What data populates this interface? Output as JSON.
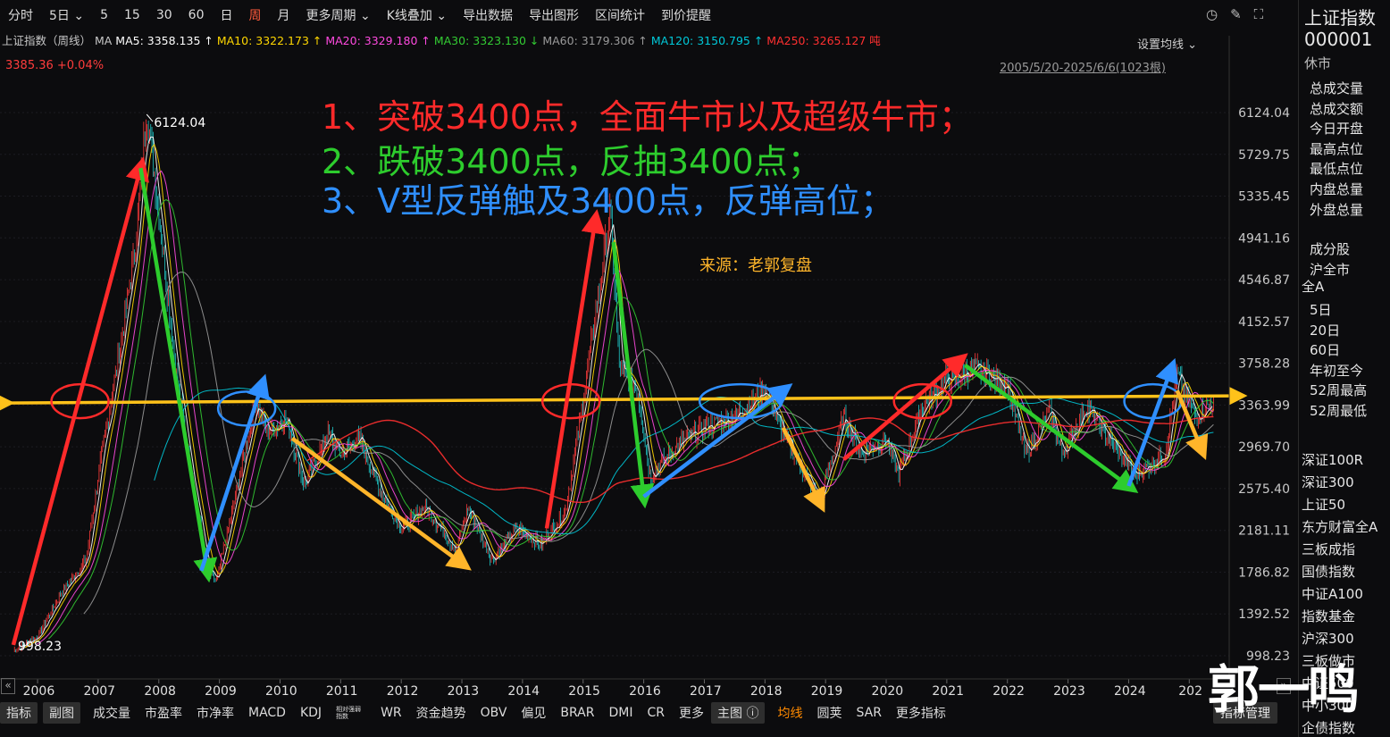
{
  "toolbar": {
    "items": [
      "分时",
      "5日 ⌄",
      "5",
      "15",
      "30",
      "60",
      "日",
      "周",
      "月",
      "更多周期 ⌄",
      "K线叠加 ⌄",
      "导出数据",
      "导出图形",
      "区间统计",
      "到价提醒"
    ],
    "active": "周",
    "icons": [
      "clock-icon",
      "pen-icon",
      "fullscreen-icon"
    ]
  },
  "ma_line": {
    "name": "上证指数（周线）",
    "prefix": "MA",
    "items": [
      {
        "label": "MA5:",
        "value": "3358.135",
        "arrow": "↑",
        "color": "#ffffff"
      },
      {
        "label": "MA10:",
        "value": "3322.173",
        "arrow": "↑",
        "color": "#ffd700"
      },
      {
        "label": "MA20:",
        "value": "3329.180",
        "arrow": "↑",
        "color": "#ff4ae0"
      },
      {
        "label": "MA30:",
        "value": "3323.130",
        "arrow": "↓",
        "color": "#33cc33"
      },
      {
        "label": "MA60:",
        "value": "3179.306",
        "arrow": "↑",
        "color": "#9a9a9a"
      },
      {
        "label": "MA120:",
        "value": "3150.795",
        "arrow": "↑",
        "color": "#00c8d8"
      },
      {
        "label": "MA250:",
        "value": "3265.127",
        "arrow": "吨",
        "color": "#ff3030"
      }
    ]
  },
  "price": "3385.36  +0.04%",
  "set_ma": "设置均线 ⌄",
  "range": "2005/5/20-2025/6/6(1023根)",
  "y_axis": [
    "6124.04",
    "5729.75",
    "5335.45",
    "4941.16",
    "4546.87",
    "4152.57",
    "3758.28",
    "3363.99",
    "2969.70",
    "2575.40",
    "2181.11",
    "1786.82",
    "1392.52",
    "998.23"
  ],
  "x_axis": [
    "2006",
    "2007",
    "2008",
    "2009",
    "2010",
    "2011",
    "2012",
    "2013",
    "2014",
    "2015",
    "2016",
    "2017",
    "2018",
    "2019",
    "2020",
    "2021",
    "2022",
    "2023",
    "2024",
    "202"
  ],
  "peak_label": "6124.04",
  "low_label": "998.23",
  "annotations": [
    {
      "text": "1、突破3400点，全面牛市以及超级牛市；",
      "color": "#ff2a2a"
    },
    {
      "text": "2、跌破3400点，反抽3400点；",
      "color": "#2dcc2d"
    },
    {
      "text": "3、V型反弹触及3400点，反弹高位；",
      "color": "#2f8fff"
    }
  ],
  "source": "来源：老郭复盘",
  "watermark": "郭一鸣",
  "sidebar": {
    "title": "上证指数",
    "code": "000001",
    "status": "休市",
    "stats": [
      "总成交量",
      "总成交额",
      "今日开盘",
      "最高点位",
      "最低点位",
      "内盘总量",
      "外盘总量"
    ],
    "group": [
      "成分股",
      "沪全市",
      "全A"
    ],
    "periods": [
      "5日",
      "20日",
      "60日",
      "年初至今",
      "52周最高",
      "52周最低"
    ],
    "indices": [
      "深证100R",
      "深证300",
      "上证50",
      "东方财富全A",
      "三板成指",
      "国债指数",
      "中证A100",
      "指数基金",
      "沪深300",
      "三板做市",
      "中证500",
      "中小300",
      "企债指数"
    ]
  },
  "bottom": {
    "items": [
      "指标",
      "副图",
      "成交量",
      "市盈率",
      "市净率",
      "MACD",
      "KDJ",
      "相对强弱指数",
      "WR",
      "资金趋势",
      "OBV",
      "偏见",
      "BRAR",
      "DMI",
      "CR",
      "更多",
      "主图 ⓘ",
      "均线",
      "圆荚",
      "SAR",
      "更多指标"
    ],
    "manage": "指标管理"
  },
  "chart_data": {
    "type": "candlestick",
    "period": "weekly",
    "ylim": [
      998.23,
      6124.04
    ],
    "support_level": 3400,
    "x_labels": [
      "2006",
      "2007",
      "2008",
      "2009",
      "2010",
      "2011",
      "2012",
      "2013",
      "2014",
      "2015",
      "2016",
      "2017",
      "2018",
      "2019",
      "2020",
      "2021",
      "2022",
      "2023",
      "2024",
      "202"
    ],
    "path": [
      [
        2005.6,
        1050
      ],
      [
        2006.0,
        1180
      ],
      [
        2006.4,
        1600
      ],
      [
        2006.8,
        1900
      ],
      [
        2007.0,
        2700
      ],
      [
        2007.3,
        3700
      ],
      [
        2007.6,
        4800
      ],
      [
        2007.8,
        6124
      ],
      [
        2008.0,
        5200
      ],
      [
        2008.3,
        3600
      ],
      [
        2008.6,
        2500
      ],
      [
        2008.8,
        1800
      ],
      [
        2008.95,
        1700
      ],
      [
        2009.3,
        2600
      ],
      [
        2009.6,
        3400
      ],
      [
        2009.8,
        3100
      ],
      [
        2010.1,
        3250
      ],
      [
        2010.4,
        2600
      ],
      [
        2010.8,
        3100
      ],
      [
        2011.0,
        2900
      ],
      [
        2011.3,
        3050
      ],
      [
        2011.7,
        2500
      ],
      [
        2012.0,
        2200
      ],
      [
        2012.4,
        2400
      ],
      [
        2012.9,
        2000
      ],
      [
        2013.1,
        2400
      ],
      [
        2013.5,
        1900
      ],
      [
        2013.9,
        2200
      ],
      [
        2014.3,
        2050
      ],
      [
        2014.7,
        2350
      ],
      [
        2014.95,
        3200
      ],
      [
        2015.2,
        4200
      ],
      [
        2015.45,
        5178
      ],
      [
        2015.6,
        3700
      ],
      [
        2015.9,
        3500
      ],
      [
        2016.1,
        2700
      ],
      [
        2016.6,
        3000
      ],
      [
        2017.0,
        3150
      ],
      [
        2017.5,
        3250
      ],
      [
        2018.0,
        3500
      ],
      [
        2018.3,
        3100
      ],
      [
        2018.9,
        2450
      ],
      [
        2019.3,
        3250
      ],
      [
        2019.6,
        2900
      ],
      [
        2020.0,
        3050
      ],
      [
        2020.2,
        2700
      ],
      [
        2020.6,
        3350
      ],
      [
        2021.0,
        3600
      ],
      [
        2021.5,
        3700
      ],
      [
        2022.0,
        3550
      ],
      [
        2022.3,
        2900
      ],
      [
        2022.7,
        3300
      ],
      [
        2022.9,
        2900
      ],
      [
        2023.3,
        3350
      ],
      [
        2023.8,
        2950
      ],
      [
        2024.1,
        2700
      ],
      [
        2024.6,
        2900
      ],
      [
        2024.8,
        3650
      ],
      [
        2025.1,
        3250
      ],
      [
        2025.4,
        3385
      ]
    ],
    "ma_series": [
      {
        "name": "MA5",
        "color": "#ffffff"
      },
      {
        "name": "MA10",
        "color": "#ffd700"
      },
      {
        "name": "MA20",
        "color": "#ff4ae0"
      },
      {
        "name": "MA30",
        "color": "#33cc33"
      },
      {
        "name": "MA60",
        "color": "#9a9a9a"
      },
      {
        "name": "MA120",
        "color": "#00c8d8"
      },
      {
        "name": "MA250",
        "color": "#ff3030"
      }
    ],
    "arrows": [
      {
        "color": "#ff2a2a",
        "from": [
          2005.6,
          1100
        ],
        "to": [
          2007.7,
          5600
        ]
      },
      {
        "color": "#ff2a2a",
        "from": [
          2014.4,
          2200
        ],
        "to": [
          2015.2,
          5100
        ]
      },
      {
        "color": "#ff2a2a",
        "from": [
          2019.3,
          2850
        ],
        "to": [
          2021.2,
          3780
        ]
      },
      {
        "color": "#2dcc2d",
        "from": [
          2007.7,
          5600
        ],
        "to": [
          2008.8,
          1800
        ]
      },
      {
        "color": "#2dcc2d",
        "from": [
          2015.5,
          4900
        ],
        "to": [
          2016.0,
          2500
        ]
      },
      {
        "color": "#2dcc2d",
        "from": [
          2021.3,
          3740
        ],
        "to": [
          2024.0,
          2600
        ]
      },
      {
        "color": "#2f8fff",
        "from": [
          2008.7,
          1800
        ],
        "to": [
          2009.7,
          3550
        ]
      },
      {
        "color": "#2f8fff",
        "from": [
          2016.0,
          2500
        ],
        "to": [
          2018.3,
          3500
        ]
      },
      {
        "color": "#2f8fff",
        "from": [
          2024.0,
          2600
        ],
        "to": [
          2024.7,
          3700
        ]
      },
      {
        "color": "#ffb52a",
        "from": [
          2010.2,
          3050
        ],
        "to": [
          2013.0,
          1870
        ]
      },
      {
        "color": "#ffb52a",
        "from": [
          2018.3,
          3150
        ],
        "to": [
          2018.9,
          2450
        ]
      },
      {
        "color": "#ffb52a",
        "from": [
          2024.8,
          3500
        ],
        "to": [
          2025.2,
          2950
        ]
      }
    ],
    "ellipses": [
      {
        "color": "#ff2a2a",
        "x": 2006.7,
        "y": 3400
      },
      {
        "color": "#ff2a2a",
        "x": 2014.8,
        "y": 3400
      },
      {
        "color": "#ff2a2a",
        "x": 2020.6,
        "y": 3400
      },
      {
        "color": "#2f8fff",
        "x": 2009.45,
        "y": 3330
      },
      {
        "color": "#2f8fff",
        "x": 2017.6,
        "y": 3400
      },
      {
        "color": "#2f8fff",
        "x": 2024.4,
        "y": 3400
      }
    ]
  }
}
